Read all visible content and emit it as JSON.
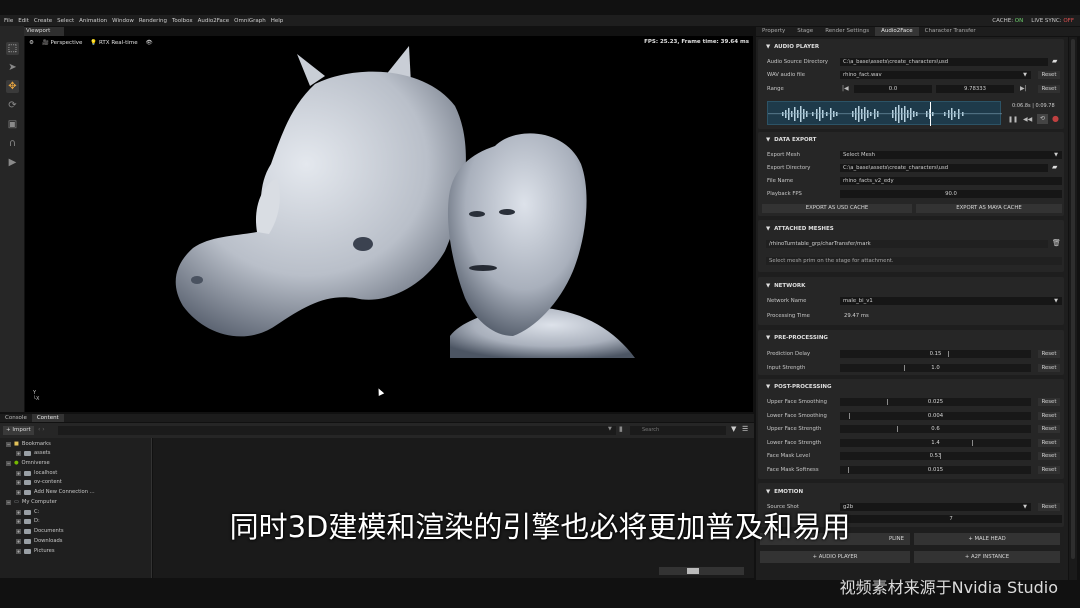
{
  "menu": [
    "File",
    "Edit",
    "Create",
    "Select",
    "Animation",
    "Window",
    "Rendering",
    "Toolbox",
    "Audio2Face",
    "OmniGraph",
    "Help"
  ],
  "status": {
    "cache_label": "CACHE:",
    "cache_value": "ON",
    "live_label": "LIVE SYNC:",
    "live_value": "OFF",
    "cache_color": "#6fd36f",
    "live_color": "#e05050"
  },
  "viewport": {
    "tab": "Viewport",
    "camera": "Perspective",
    "renderer": "RTX Real-time",
    "fps": "FPS: 25.23, Frame time: 39.64 ms",
    "axis_y": "Y",
    "axis_x": "X"
  },
  "bottom": {
    "tabs": [
      "Console",
      "Content"
    ],
    "import_label": "Import",
    "search_placeholder": "Search",
    "tree": [
      {
        "label": "Bookmarks",
        "level": 0
      },
      {
        "label": "assets",
        "level": 1
      },
      {
        "label": "Omniverse",
        "level": 0
      },
      {
        "label": "localhost",
        "level": 1
      },
      {
        "label": "ov-content",
        "level": 1
      },
      {
        "label": "Add New Connection ...",
        "level": 1
      },
      {
        "label": "My Computer",
        "level": 0
      },
      {
        "label": "C:",
        "level": 1
      },
      {
        "label": "D:",
        "level": 1
      },
      {
        "label": "Documents",
        "level": 1
      },
      {
        "label": "Downloads",
        "level": 1
      },
      {
        "label": "Pictures",
        "level": 1
      }
    ]
  },
  "right": {
    "tabs": [
      "Property",
      "Stage",
      "Render Settings",
      "Audio2Face",
      "Character Transfer"
    ],
    "reset_label": "Reset",
    "audio_player": {
      "title": "AUDIO PLAYER",
      "dir_label": "Audio Source Directory",
      "dir_value": "C:\\a_base\\assets\\create_characters\\usd",
      "wav_label": "WAV audio file",
      "wav_value": "rhino_fact.wav",
      "range_label": "Range",
      "range_start": "0.0",
      "range_end": "9.78333",
      "time_cur": "0:06.8s",
      "time_total": "0:09.78"
    },
    "data_export": {
      "title": "DATA EXPORT",
      "mesh_label": "Export Mesh",
      "mesh_value": "Select Mesh",
      "dir_label": "Export Directory",
      "dir_value": "C:\\a_base\\assets\\create_characters\\usd",
      "file_label": "File Name",
      "file_value": "rhino_facts_v2_edy",
      "fps_label": "Playback FPS",
      "fps_value": "90.0",
      "btn_usd": "EXPORT AS USD CACHE",
      "btn_maya": "EXPORT AS MAYA CACHE"
    },
    "attached": {
      "title": "ATTACHED MESHES",
      "path": "/rhinoTurntable_grp/charTransfer/mark",
      "hint": "Select mesh prim on the stage for attachment."
    },
    "network": {
      "title": "NETWORK",
      "name_label": "Network Name",
      "name_value": "male_bi_v1",
      "time_label": "Processing Time",
      "time_value": "29.47 ms"
    },
    "pre": {
      "title": "PRE-PROCESSING",
      "items": [
        {
          "label": "Prediction Delay",
          "value": "0.15",
          "frac": 0.57
        },
        {
          "label": "Input Strength",
          "value": "1.0",
          "frac": 0.34
        }
      ]
    },
    "post": {
      "title": "POST-PROCESSING",
      "items": [
        {
          "label": "Upper Face Smoothing",
          "value": "0.025",
          "frac": 0.25
        },
        {
          "label": "Lower Face Smoothing",
          "value": "0.004",
          "frac": 0.05
        },
        {
          "label": "Upper Face Strength",
          "value": "0.6",
          "frac": 0.3
        },
        {
          "label": "Lower Face Strength",
          "value": "1.4",
          "frac": 0.7
        },
        {
          "label": "Face Mask Level",
          "value": "0.53",
          "frac": 0.53
        },
        {
          "label": "Face Mask Softness",
          "value": "0.015",
          "frac": 0.04
        }
      ]
    },
    "emotion": {
      "title": "EMOTION",
      "shot_label": "Source Shot",
      "shot_value": "g2b",
      "frame_value": "7"
    },
    "bottom_buttons": {
      "male_head": "MALE HEAD",
      "audio_player": "AUDIO PLAYER",
      "a2f_instance": "A2F INSTANCE",
      "partial": "PLINE"
    }
  },
  "subtitle": "同时3D建模和渲染的引擎也必将更加普及和易用",
  "watermark": "视频素材来源于Nvidia Studio"
}
